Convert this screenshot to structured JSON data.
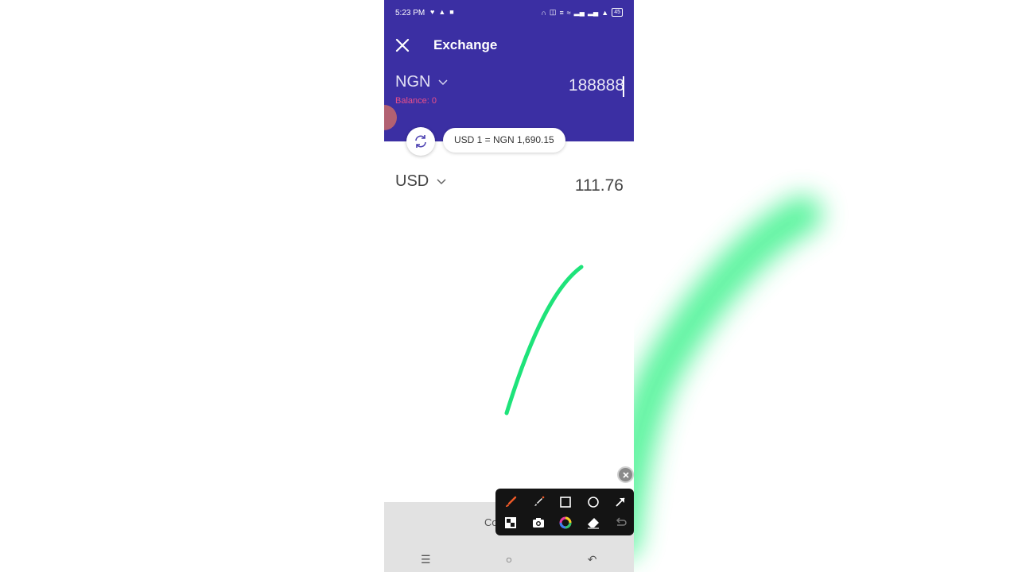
{
  "status_bar": {
    "time": "5:23 PM",
    "left_icons": [
      "notification-icon",
      "alert-icon",
      "video-icon"
    ],
    "right_icons": [
      "headphones-icon",
      "cast-icon",
      "volte-icon",
      "wifi-icon",
      "signal-icon",
      "signal-icon",
      "lab-icon"
    ],
    "battery": "45"
  },
  "header": {
    "title": "Exchange",
    "close_icon": "close-icon"
  },
  "from": {
    "currency": "NGN",
    "balance": "Balance: 0",
    "amount": "188888"
  },
  "rate": {
    "text": "USD 1 = NGN 1,690.15",
    "swap_icon": "refresh-icon"
  },
  "to": {
    "currency": "USD",
    "amount": "111.76"
  },
  "bottom": {
    "continue_label": "Co"
  },
  "nav_bar": {
    "items": [
      "menu-icon",
      "home-icon",
      "back-icon"
    ]
  },
  "annotation_toolbar": {
    "tools_row1": [
      "brush-icon",
      "highlighter-icon",
      "rectangle-icon",
      "circle-icon",
      "arrow-icon"
    ],
    "tools_row2": [
      "mosaic-icon",
      "camera-icon",
      "color-wheel-icon",
      "eraser-icon",
      "undo-icon"
    ],
    "accent_color": "#f05a28",
    "stroke_color": "#1ee37a"
  }
}
